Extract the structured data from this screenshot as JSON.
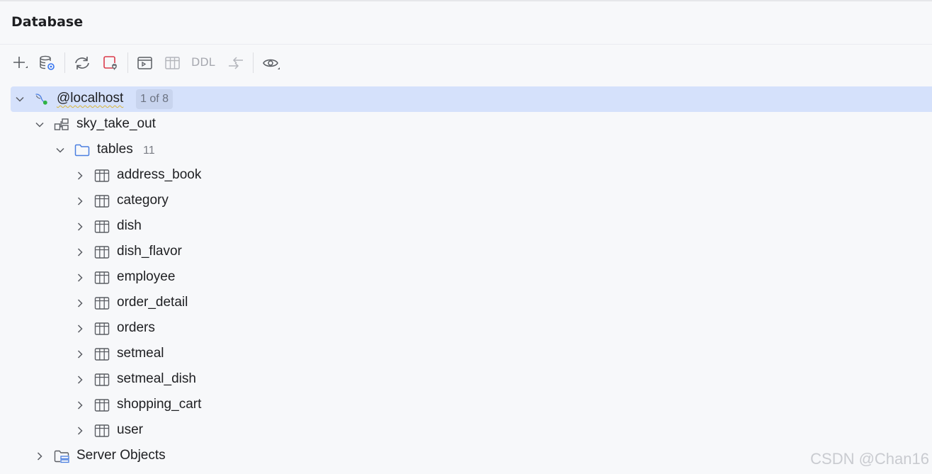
{
  "panel": {
    "title": "Database"
  },
  "toolbar": {
    "buttons": [
      {
        "icon": "plus-icon"
      },
      {
        "icon": "data-source-properties-icon"
      },
      {
        "icon": "refresh-icon"
      },
      {
        "icon": "disconnect-icon"
      },
      {
        "icon": "query-console-icon"
      },
      {
        "icon": "table-editor-icon"
      },
      {
        "icon": "compare-icon"
      },
      {
        "icon": "view-options-icon"
      }
    ],
    "ddl_label": "DDL"
  },
  "tree": {
    "connection": {
      "label": "@localhost",
      "badge": "1 of 8",
      "status_color": "#2fb344"
    },
    "schema": {
      "label": "sky_take_out"
    },
    "tables_folder": {
      "label": "tables",
      "count": "11"
    },
    "tables": [
      "address_book",
      "category",
      "dish",
      "dish_flavor",
      "employee",
      "order_detail",
      "orders",
      "setmeal",
      "setmeal_dish",
      "shopping_cart",
      "user"
    ],
    "server_objects": {
      "label": "Server Objects"
    }
  },
  "watermark": "CSDN @Chan16",
  "colors": {
    "selection": "#d5e1fb",
    "folder_blue": "#4a7ee0",
    "background": "#f7f8fa"
  }
}
